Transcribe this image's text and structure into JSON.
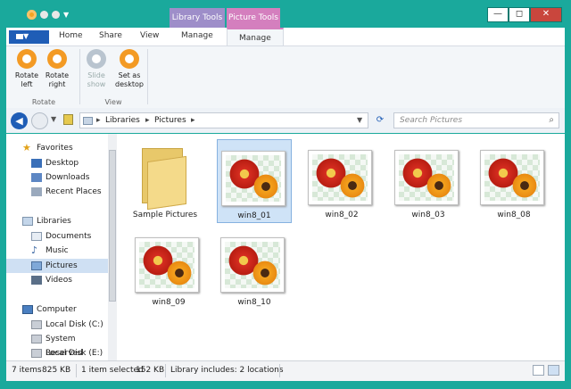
{
  "window": {
    "minimize": "—",
    "maximize": "◻",
    "close": "✕"
  },
  "context_tabs": {
    "library": "Library Tools",
    "picture": "Picture Tools"
  },
  "ribbon": {
    "tabs": [
      "Home",
      "Share",
      "View",
      "Manage",
      "Manage"
    ],
    "groups": {
      "rotate": {
        "label": "Rotate",
        "buttons": [
          {
            "line1": "Rotate",
            "line2": "left"
          },
          {
            "line1": "Rotate",
            "line2": "right"
          }
        ]
      },
      "view": {
        "label": "View",
        "buttons": [
          {
            "line1": "Slide",
            "line2": "show"
          },
          {
            "line1": "Set as",
            "line2": "desktop"
          }
        ]
      }
    }
  },
  "address": {
    "crumbs": [
      "Libraries",
      "Pictures"
    ],
    "search_placeholder": "Search Pictures"
  },
  "sidebar": {
    "favorites": {
      "label": "Favorites",
      "items": [
        "Desktop",
        "Downloads",
        "Recent Places"
      ]
    },
    "libraries": {
      "label": "Libraries",
      "items": [
        "Documents",
        "Music",
        "Pictures",
        "Videos"
      ]
    },
    "computer": {
      "label": "Computer",
      "items": [
        "Local Disk (C:)",
        "System Reserved",
        "Local Disk (E:)"
      ]
    }
  },
  "files": [
    {
      "name": "Sample Pictures",
      "type": "folder"
    },
    {
      "name": "win8_01",
      "type": "image",
      "selected": true
    },
    {
      "name": "win8_02",
      "type": "image"
    },
    {
      "name": "win8_03",
      "type": "image"
    },
    {
      "name": "win8_08",
      "type": "image"
    },
    {
      "name": "win8_09",
      "type": "image"
    },
    {
      "name": "win8_10",
      "type": "image"
    }
  ],
  "status": {
    "count": "7 items",
    "size": "825 KB",
    "selected": "1 item selected",
    "selected_size": "152 KB",
    "library": "Library includes:  2 locations"
  }
}
